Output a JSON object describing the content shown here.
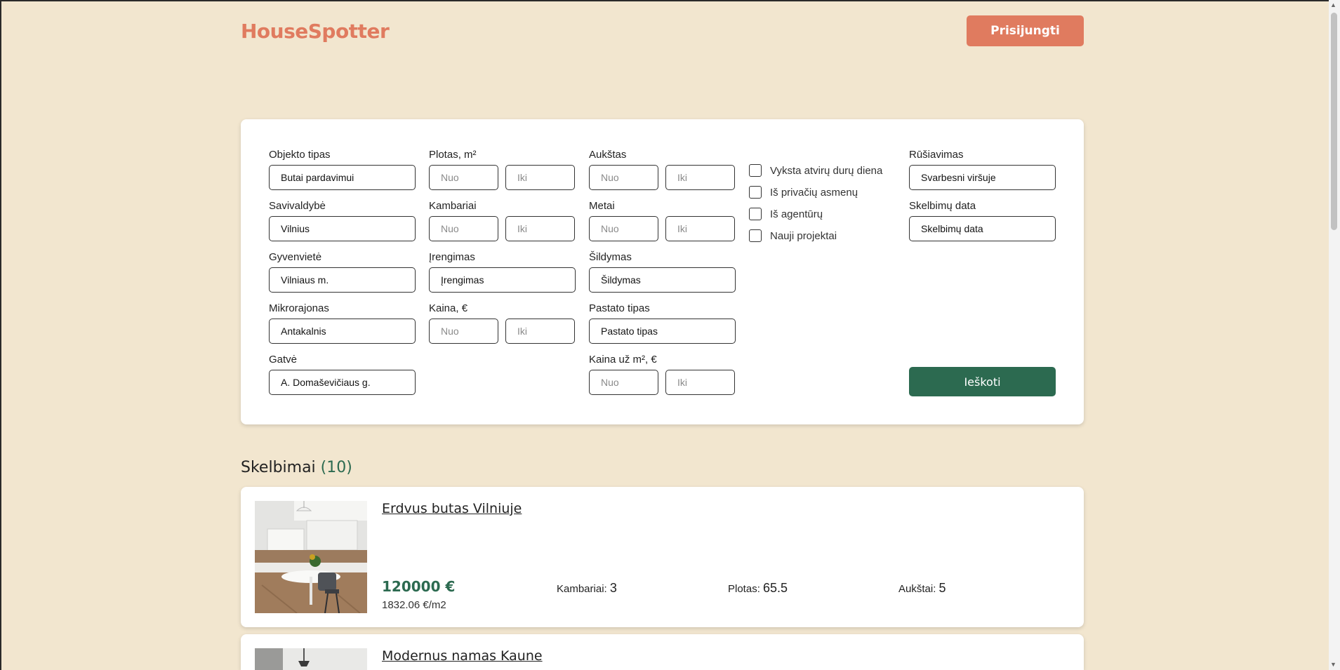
{
  "header": {
    "brand": "HouseSpotter",
    "login_label": "Prisijungti"
  },
  "filters": {
    "object_type": {
      "label": "Objekto tipas",
      "value": "Butai pardavimui"
    },
    "municipality": {
      "label": "Savivaldybė",
      "value": "Vilnius"
    },
    "settlement": {
      "label": "Gyvenvietė",
      "value": "Vilniaus m."
    },
    "microdistrict": {
      "label": "Mikrorajonas",
      "value": "Antakalnis"
    },
    "street": {
      "label": "Gatvė",
      "value": "A. Domaševičiaus g."
    },
    "area": {
      "label": "Plotas, m²",
      "from": "Nuo",
      "to": "Iki"
    },
    "rooms": {
      "label": "Kambariai",
      "from": "Nuo",
      "to": "Iki"
    },
    "equipment": {
      "label": "Įrengimas",
      "value": "Įrengimas"
    },
    "price": {
      "label": "Kaina, €",
      "from": "Nuo",
      "to": "Iki"
    },
    "floor": {
      "label": "Aukštas",
      "from": "Nuo",
      "to": "Iki"
    },
    "year": {
      "label": "Metai",
      "from": "Nuo",
      "to": "Iki"
    },
    "heating": {
      "label": "Šildymas",
      "value": "Šildymas"
    },
    "building_type": {
      "label": "Pastato tipas",
      "value": "Pastato tipas"
    },
    "price_per_m2": {
      "label": "Kaina už m², €",
      "from": "Nuo",
      "to": "Iki"
    },
    "checkboxes": [
      "Vyksta atvirų durų diena",
      "Iš privačių asmenų",
      "Iš agentūrų",
      "Nauji projektai"
    ],
    "sorting": {
      "label": "Rūšiavimas",
      "value": "Svarbesni viršuje"
    },
    "listing_date": {
      "label": "Skelbimų data",
      "value": "Skelbimų data"
    },
    "search_label": "Ieškoti"
  },
  "results": {
    "title": "Skelbimai",
    "count": "(10)",
    "listings": [
      {
        "title": "Erdvus butas Vilniuje",
        "price": "120000 €",
        "price_per_m2": "1832.06 €/m2",
        "rooms_label": "Kambariai:",
        "rooms": "3",
        "area_label": "Plotas:",
        "area": "65.5",
        "floors_label": "Aukštai:",
        "floors": "5"
      },
      {
        "title": "Modernus namas Kaune"
      }
    ]
  },
  "colors": {
    "background": "#f2e6cf",
    "accent": "#e07b5f",
    "primary": "#2c6a50"
  },
  "icons": {
    "scroll_up": "scroll-up-arrow-icon",
    "scroll_down": "scroll-down-arrow-icon"
  }
}
